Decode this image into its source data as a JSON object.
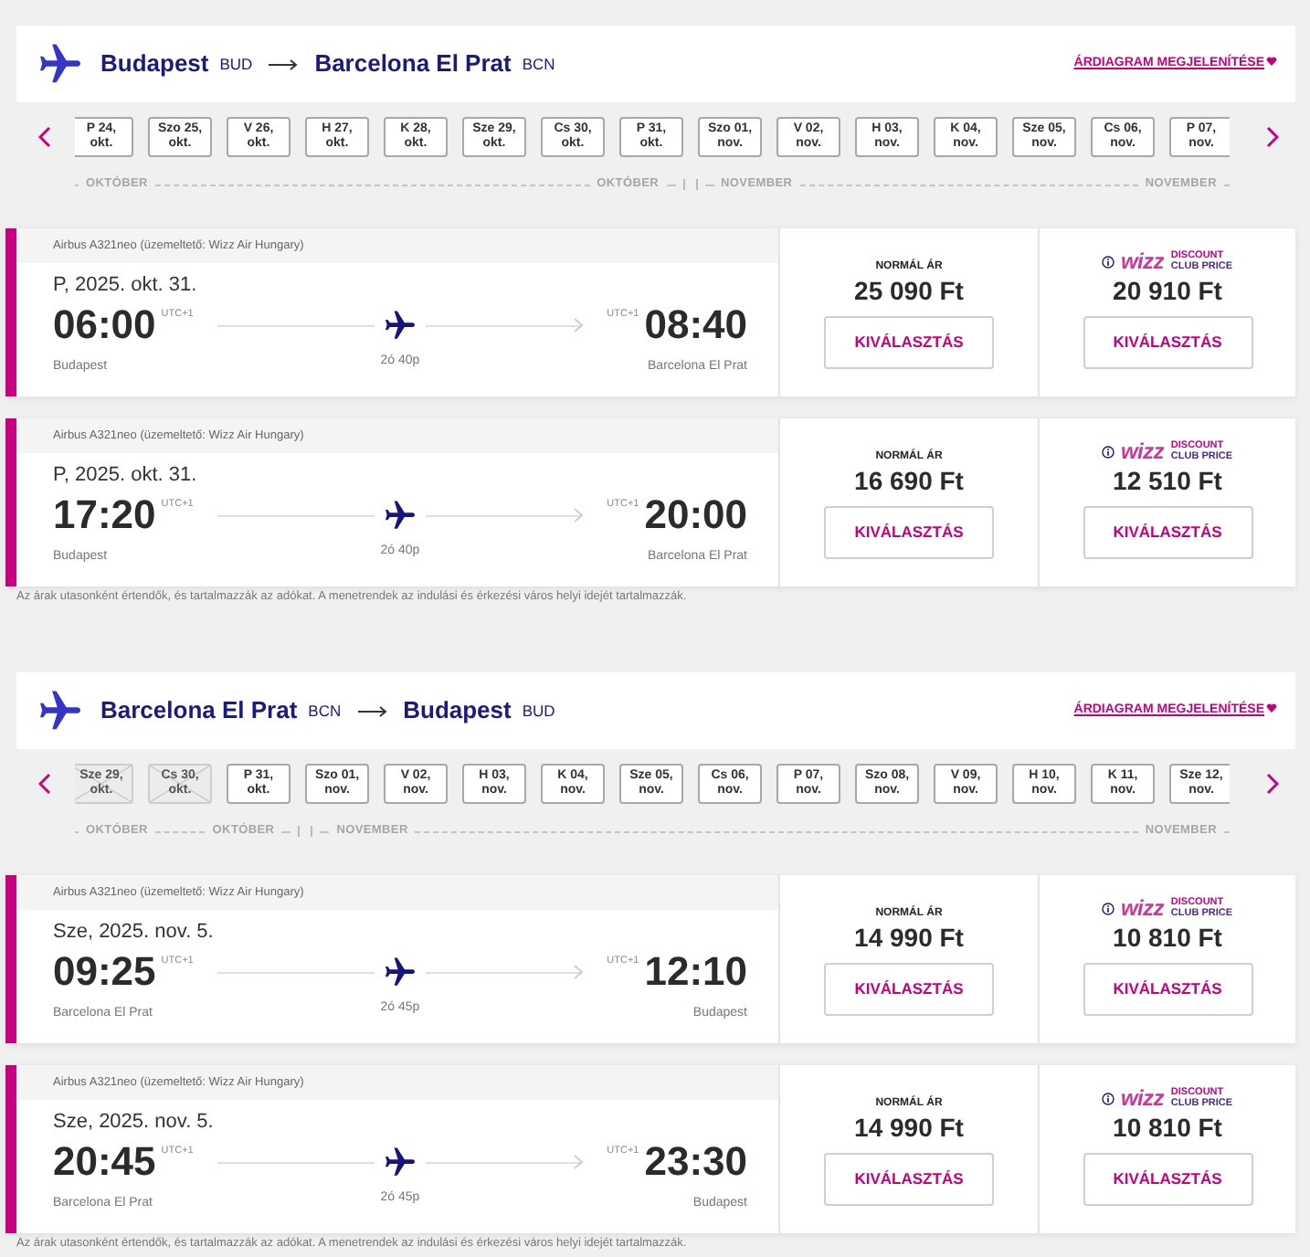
{
  "sections": [
    {
      "route": {
        "from_city": "Budapest",
        "from_code": "BUD",
        "to_city": "Barcelona El Prat",
        "to_code": "BCN"
      },
      "price_chart_link": "ÁRDIAGRAM MEGJELENÍTÉSE",
      "date_strip": {
        "months": [
          {
            "start_label": "OKTÓBER",
            "end_label": "OKTÓBER",
            "days": [
              {
                "day": "P 24,",
                "month": "okt.",
                "disabled": false
              },
              {
                "day": "Szo 25,",
                "month": "okt.",
                "disabled": false
              },
              {
                "day": "V 26,",
                "month": "okt.",
                "disabled": false
              },
              {
                "day": "H 27,",
                "month": "okt.",
                "disabled": false
              },
              {
                "day": "K 28,",
                "month": "okt.",
                "disabled": false
              },
              {
                "day": "Sze 29,",
                "month": "okt.",
                "disabled": false
              },
              {
                "day": "Cs 30,",
                "month": "okt.",
                "disabled": false
              },
              {
                "day": "P 31,",
                "month": "okt.",
                "disabled": false
              }
            ]
          },
          {
            "start_label": "NOVEMBER",
            "end_label": "NOVEMBER",
            "days": [
              {
                "day": "Szo 01,",
                "month": "nov.",
                "disabled": false
              },
              {
                "day": "V 02,",
                "month": "nov.",
                "disabled": false
              },
              {
                "day": "H 03,",
                "month": "nov.",
                "disabled": false
              },
              {
                "day": "K 04,",
                "month": "nov.",
                "disabled": false
              },
              {
                "day": "Sze 05,",
                "month": "nov.",
                "disabled": false
              },
              {
                "day": "Cs 06,",
                "month": "nov.",
                "disabled": false
              },
              {
                "day": "P 07,",
                "month": "nov.",
                "disabled": false
              }
            ]
          }
        ]
      },
      "flights": [
        {
          "aircraft": "Airbus A321neo (üzemeltető: Wizz Air Hungary)",
          "date": "P, 2025. okt. 31.",
          "departure": {
            "time": "06:00",
            "utc": "UTC+1",
            "city": "Budapest"
          },
          "arrival": {
            "time": "08:40",
            "utc": "UTC+1",
            "city": "Barcelona El Prat"
          },
          "duration": "2ó 40p",
          "fares": [
            {
              "kind": "standard",
              "label": "NORMÁL ÁR",
              "price": "25 090 Ft",
              "button": "KIVÁLASZTÁS"
            },
            {
              "kind": "club",
              "logo_wordmark": "wizz",
              "logo_caption": [
                "DISCOUNT",
                "CLUB PRICE"
              ],
              "price": "20 910 Ft",
              "button": "KIVÁLASZTÁS"
            }
          ]
        },
        {
          "aircraft": "Airbus A321neo (üzemeltető: Wizz Air Hungary)",
          "date": "P, 2025. okt. 31.",
          "departure": {
            "time": "17:20",
            "utc": "UTC+1",
            "city": "Budapest"
          },
          "arrival": {
            "time": "20:00",
            "utc": "UTC+1",
            "city": "Barcelona El Prat"
          },
          "duration": "2ó 40p",
          "fares": [
            {
              "kind": "standard",
              "label": "NORMÁL ÁR",
              "price": "16 690 Ft",
              "button": "KIVÁLASZTÁS"
            },
            {
              "kind": "club",
              "logo_wordmark": "wizz",
              "logo_caption": [
                "DISCOUNT",
                "CLUB PRICE"
              ],
              "price": "12 510 Ft",
              "button": "KIVÁLASZTÁS"
            }
          ]
        }
      ],
      "footnote": "Az árak utasonként értendők, és tartalmazzák az adókat. A menetrendek az indulási és érkezési város helyi idejét tartalmazzák."
    },
    {
      "route": {
        "from_city": "Barcelona El Prat",
        "from_code": "BCN",
        "to_city": "Budapest",
        "to_code": "BUD"
      },
      "price_chart_link": "ÁRDIAGRAM MEGJELENÍTÉSE",
      "date_strip": {
        "months": [
          {
            "start_label": "OKTÓBER",
            "end_label": "OKTÓBER",
            "days": [
              {
                "day": "Sze 29,",
                "month": "okt.",
                "disabled": true
              },
              {
                "day": "Cs 30,",
                "month": "okt.",
                "disabled": true
              },
              {
                "day": "P 31,",
                "month": "okt.",
                "disabled": false
              }
            ]
          },
          {
            "start_label": "NOVEMBER",
            "end_label": "NOVEMBER",
            "days": [
              {
                "day": "Szo 01,",
                "month": "nov.",
                "disabled": false
              },
              {
                "day": "V 02,",
                "month": "nov.",
                "disabled": false
              },
              {
                "day": "H 03,",
                "month": "nov.",
                "disabled": false
              },
              {
                "day": "K 04,",
                "month": "nov.",
                "disabled": false
              },
              {
                "day": "Sze 05,",
                "month": "nov.",
                "disabled": false
              },
              {
                "day": "Cs 06,",
                "month": "nov.",
                "disabled": false
              },
              {
                "day": "P 07,",
                "month": "nov.",
                "disabled": false
              },
              {
                "day": "Szo 08,",
                "month": "nov.",
                "disabled": false
              },
              {
                "day": "V 09,",
                "month": "nov.",
                "disabled": false
              },
              {
                "day": "H 10,",
                "month": "nov.",
                "disabled": false
              },
              {
                "day": "K 11,",
                "month": "nov.",
                "disabled": false
              },
              {
                "day": "Sze 12,",
                "month": "nov.",
                "disabled": false
              }
            ]
          }
        ]
      },
      "flights": [
        {
          "aircraft": "Airbus A321neo (üzemeltető: Wizz Air Hungary)",
          "date": "Sze, 2025. nov. 5.",
          "departure": {
            "time": "09:25",
            "utc": "UTC+1",
            "city": "Barcelona El Prat"
          },
          "arrival": {
            "time": "12:10",
            "utc": "UTC+1",
            "city": "Budapest"
          },
          "duration": "2ó 45p",
          "fares": [
            {
              "kind": "standard",
              "label": "NORMÁL ÁR",
              "price": "14 990 Ft",
              "button": "KIVÁLASZTÁS"
            },
            {
              "kind": "club",
              "logo_wordmark": "wizz",
              "logo_caption": [
                "DISCOUNT",
                "CLUB PRICE"
              ],
              "price": "10 810 Ft",
              "button": "KIVÁLASZTÁS"
            }
          ]
        },
        {
          "aircraft": "Airbus A321neo (üzemeltető: Wizz Air Hungary)",
          "date": "Sze, 2025. nov. 5.",
          "departure": {
            "time": "20:45",
            "utc": "UTC+1",
            "city": "Barcelona El Prat"
          },
          "arrival": {
            "time": "23:30",
            "utc": "UTC+1",
            "city": "Budapest"
          },
          "duration": "2ó 45p",
          "fares": [
            {
              "kind": "standard",
              "label": "NORMÁL ÁR",
              "price": "14 990 Ft",
              "button": "KIVÁLASZTÁS"
            },
            {
              "kind": "club",
              "logo_wordmark": "wizz",
              "logo_caption": [
                "DISCOUNT",
                "CLUB PRICE"
              ],
              "price": "10 810 Ft",
              "button": "KIVÁLASZTÁS"
            }
          ]
        }
      ],
      "footnote": "Az árak utasonként értendők, és tartalmazzák az adókat. A menetrendek az indulási és érkezési város helyi idejét tartalmazzák."
    }
  ]
}
